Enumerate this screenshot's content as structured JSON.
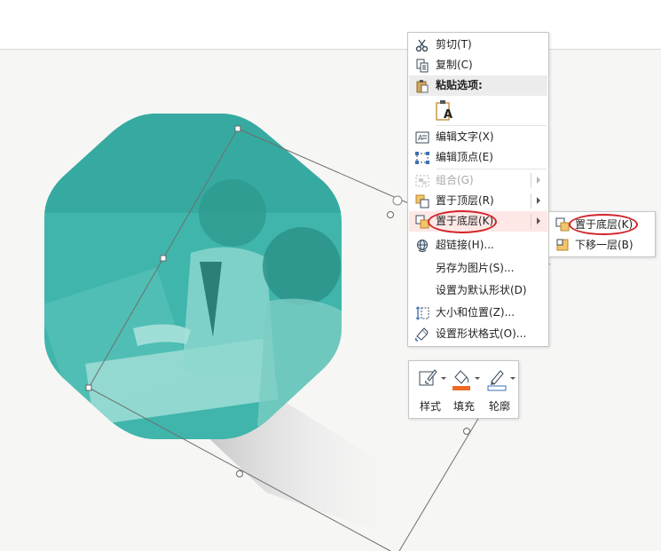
{
  "context_menu": {
    "items": [
      {
        "label": "剪切(T)",
        "icon": "scissors-icon"
      },
      {
        "label": "复制(C)",
        "icon": "copy-icon"
      },
      {
        "label": "粘贴选项:",
        "icon": "paste-icon"
      },
      {
        "label": "A",
        "icon": "paste-text-icon"
      },
      {
        "label": "编辑文字(X)",
        "icon": "edit-text-icon"
      },
      {
        "label": "编辑顶点(E)",
        "icon": "edit-points-icon"
      },
      {
        "label": "组合(G)",
        "icon": "group-icon"
      },
      {
        "label": "置于顶层(R)",
        "icon": "bring-to-front-icon"
      },
      {
        "label": "置于底层(K)",
        "icon": "send-to-back-icon"
      },
      {
        "label": "超链接(H)...",
        "icon": "hyperlink-icon"
      },
      {
        "label": "另存为图片(S)..."
      },
      {
        "label": "设置为默认形状(D)"
      },
      {
        "label": "大小和位置(Z)...",
        "icon": "size-position-icon"
      },
      {
        "label": "设置形状格式(O)...",
        "icon": "format-shape-icon"
      }
    ]
  },
  "submenu": {
    "items": [
      {
        "label": "置于底层(K)",
        "icon": "send-to-back-icon"
      },
      {
        "label": "下移一层(B)",
        "icon": "send-backward-icon"
      }
    ]
  },
  "mini_toolbar": {
    "style_label": "样式",
    "fill_label": "填充",
    "outline_label": "轮廓"
  },
  "colors": {
    "shape_fill": "#3fb5ab",
    "highlight": "#fde8e5",
    "annotation_ring": "#d2232a",
    "fill_swatch": "#ee6a22",
    "outline_swatch": "#3a6fb5"
  }
}
